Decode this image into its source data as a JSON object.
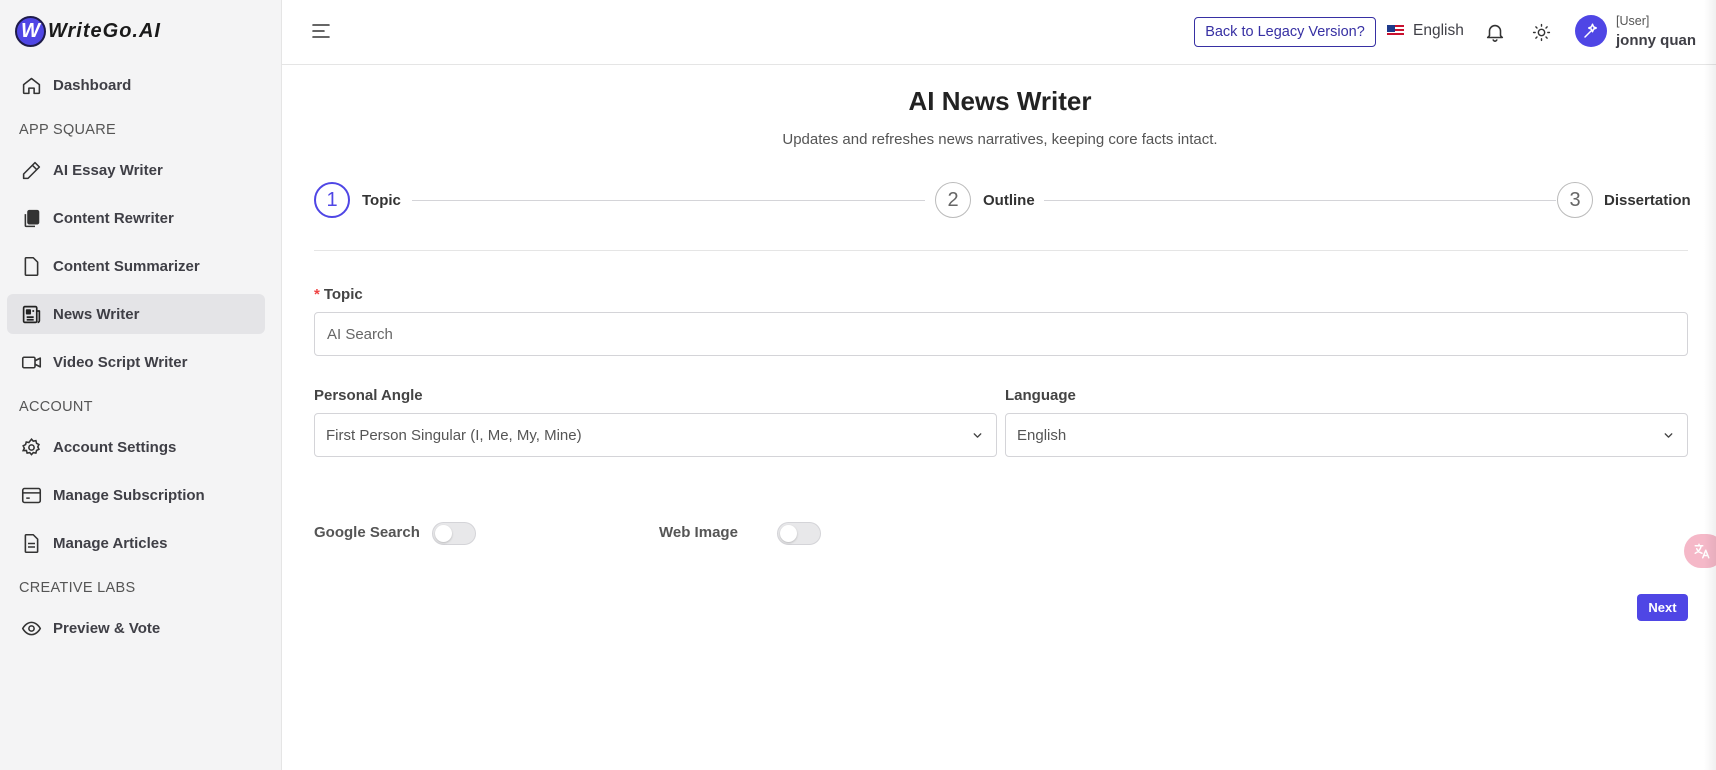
{
  "brand": {
    "badge": "W",
    "name": "WriteGo.AI"
  },
  "sidebar": {
    "dashboard": "Dashboard",
    "sections": {
      "app_square": "APP SQUARE",
      "account": "ACCOUNT",
      "creative_labs": "CREATIVE LABS"
    },
    "app_items": [
      {
        "label": "AI Essay Writer",
        "icon": "pencil-icon"
      },
      {
        "label": "Content Rewriter",
        "icon": "copy-icon"
      },
      {
        "label": "Content Summarizer",
        "icon": "document-icon"
      },
      {
        "label": "News Writer",
        "icon": "newspaper-icon",
        "active": true
      },
      {
        "label": "Video Script Writer",
        "icon": "video-icon"
      }
    ],
    "account_items": [
      {
        "label": "Account Settings",
        "icon": "gear-icon"
      },
      {
        "label": "Manage Subscription",
        "icon": "card-icon"
      },
      {
        "label": "Manage Articles",
        "icon": "file-text-icon"
      }
    ],
    "lab_items": [
      {
        "label": "Preview & Vote",
        "icon": "eye-icon"
      }
    ]
  },
  "header": {
    "legacy_label": "Back to Legacy Version?",
    "language": "English",
    "user_role": "[User]",
    "user_name": "jonny quan"
  },
  "main": {
    "title": "AI News Writer",
    "subtitle": "Updates and refreshes news narratives, keeping core facts intact.",
    "steps": [
      {
        "number": "1",
        "label": "Topic",
        "active": true
      },
      {
        "number": "2",
        "label": "Outline"
      },
      {
        "number": "3",
        "label": "Dissertation"
      }
    ],
    "topic": {
      "required_mark": "*",
      "label": "Topic",
      "placeholder": "AI Search",
      "value": ""
    },
    "personal_angle": {
      "label": "Personal Angle",
      "value": "First Person Singular (I, Me, My, Mine)"
    },
    "language": {
      "label": "Language",
      "value": "English"
    },
    "google_search": {
      "label": "Google Search",
      "enabled": false
    },
    "web_image": {
      "label": "Web Image",
      "enabled": false
    },
    "next_label": "Next"
  },
  "colors": {
    "accent": "#4f46e5",
    "required": "#ef4444",
    "sidebar_bg": "#f4f4f5"
  }
}
